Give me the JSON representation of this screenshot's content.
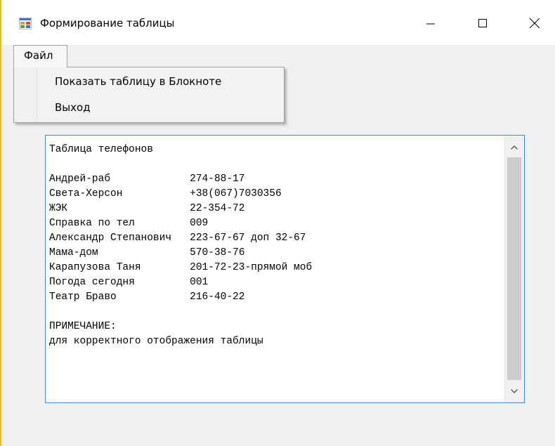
{
  "window": {
    "title": "Формирование таблицы",
    "icon": "form-app-icon",
    "controls": {
      "minimize": "minimize-icon",
      "maximize": "maximize-icon",
      "close": "close-icon"
    }
  },
  "menu": {
    "file_label": "Файл",
    "items": [
      {
        "label": "Показать таблицу в Блокноте"
      },
      {
        "label": "Выход"
      }
    ]
  },
  "textbox": {
    "content": "Таблица телефонов\n\nАндрей-раб             274-88-17\nСвета-Херсон           +38(067)7030356\nЖЭК                    22-354-72\nСправка по тел         009\nАлександр Степанович   223-67-67 доп 32-67\nМама-дом               570-38-76\nКарапузова Таня        201-72-23-прямой моб\nПогода сегодня         001\nТеатр Браво            216-40-22\n\nПРИМЕЧАНИЕ:\nдля корректного отображения таблицы"
  },
  "colors": {
    "accent_border": "#3c8bd8",
    "window_bg": "#f0f0f0",
    "left_accent": "#f2b33d"
  }
}
